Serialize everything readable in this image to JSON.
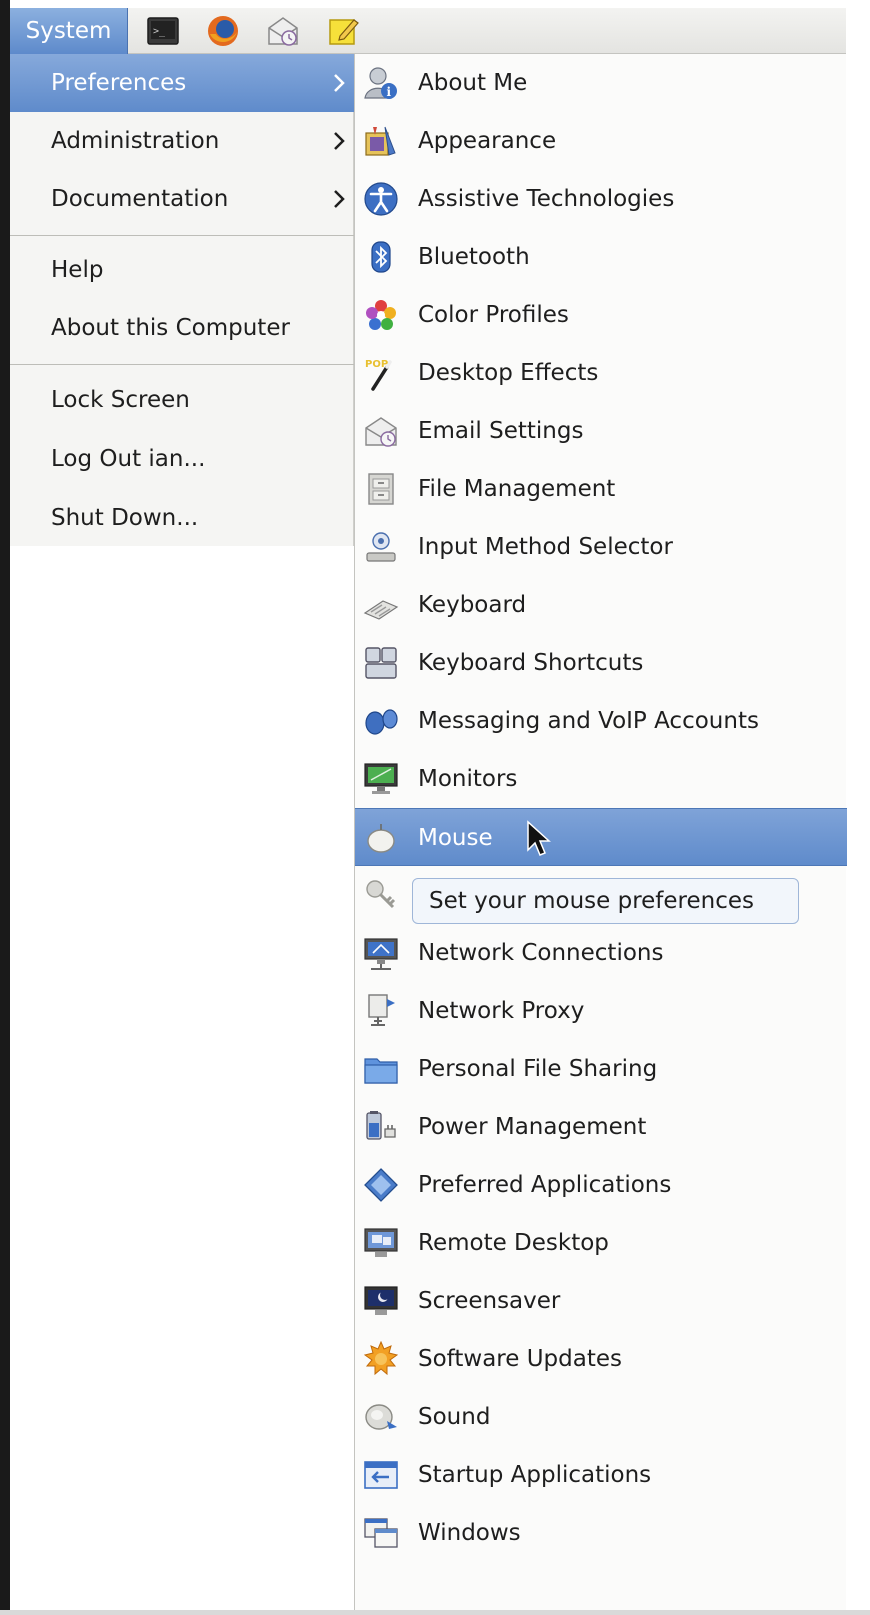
{
  "panel": {
    "system_label": "System",
    "launchers": [
      {
        "icon": "terminal-icon"
      },
      {
        "icon": "firefox-icon"
      },
      {
        "icon": "email-settings-icon"
      },
      {
        "icon": "notes-icon"
      }
    ]
  },
  "system_menu": {
    "items": [
      {
        "label": "Preferences",
        "submenu": true,
        "active": true
      },
      {
        "label": "Administration",
        "submenu": true
      },
      {
        "label": "Documentation",
        "submenu": true
      },
      {
        "label": "Help"
      },
      {
        "label": "About this Computer"
      },
      {
        "label": "Lock Screen"
      },
      {
        "label": "Log Out ian..."
      },
      {
        "label": "Shut Down..."
      }
    ]
  },
  "preferences_menu": {
    "items": [
      {
        "label": "About Me",
        "icon": "about-me-icon"
      },
      {
        "label": "Appearance",
        "icon": "appearance-icon"
      },
      {
        "label": "Assistive Technologies",
        "icon": "accessibility-icon"
      },
      {
        "label": "Bluetooth",
        "icon": "bluetooth-icon"
      },
      {
        "label": "Color Profiles",
        "icon": "color-profiles-icon"
      },
      {
        "label": "Desktop Effects",
        "icon": "desktop-effects-icon"
      },
      {
        "label": "Email Settings",
        "icon": "email-settings-icon"
      },
      {
        "label": "File Management",
        "icon": "file-management-icon"
      },
      {
        "label": "Input Method Selector",
        "icon": "input-method-icon"
      },
      {
        "label": "Keyboard",
        "icon": "keyboard-icon"
      },
      {
        "label": "Keyboard Shortcuts",
        "icon": "keyboard-shortcuts-icon"
      },
      {
        "label": "Messaging and VoIP Accounts",
        "icon": "messaging-icon"
      },
      {
        "label": "Monitors",
        "icon": "monitors-icon"
      },
      {
        "label": "Mouse",
        "icon": "mouse-icon",
        "hovered": true
      },
      {
        "label": "",
        "icon": "network-authentication-icon"
      },
      {
        "label": "Network Connections",
        "icon": "network-connections-icon"
      },
      {
        "label": "Network Proxy",
        "icon": "network-proxy-icon"
      },
      {
        "label": "Personal File Sharing",
        "icon": "file-sharing-icon"
      },
      {
        "label": "Power Management",
        "icon": "power-management-icon"
      },
      {
        "label": "Preferred Applications",
        "icon": "preferred-applications-icon"
      },
      {
        "label": "Remote Desktop",
        "icon": "remote-desktop-icon"
      },
      {
        "label": "Screensaver",
        "icon": "screensaver-icon"
      },
      {
        "label": "Software Updates",
        "icon": "software-updates-icon"
      },
      {
        "label": "Sound",
        "icon": "sound-icon"
      },
      {
        "label": "Startup Applications",
        "icon": "startup-applications-icon"
      },
      {
        "label": "Windows",
        "icon": "windows-icon"
      }
    ]
  },
  "tooltip": {
    "text": "Set your mouse preferences"
  },
  "colors": {
    "highlight": "#6e96d2",
    "menu_bg": "#f5f5f3",
    "panel_bg": "#ebebe8"
  }
}
